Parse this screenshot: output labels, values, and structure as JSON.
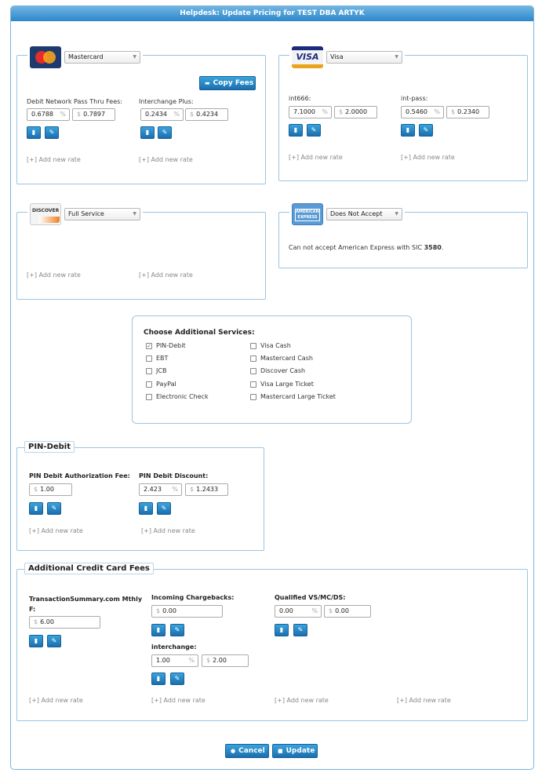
{
  "title": "Helpdesk: Update Pricing for TEST DBA ARTYK",
  "common": {
    "add_new_rate": "[+] Add new rate",
    "percent": "%",
    "dollar": "$",
    "delete_icon": "trash-icon",
    "edit_icon": "pencil-icon"
  },
  "mastercard": {
    "select_value": "Mastercard",
    "copy_fees_label": "Copy Fees",
    "rates": [
      {
        "label": "Debit Network Pass Thru Fees:",
        "percent": "0.6788",
        "fixed": "0.7897"
      },
      {
        "label": "Interchange Plus:",
        "percent": "0.2434",
        "fixed": "0.4234"
      }
    ]
  },
  "visa": {
    "select_value": "Visa",
    "rates": [
      {
        "label": "int666:",
        "percent": "7.1000",
        "fixed": "2.0000"
      },
      {
        "label": "int-pass:",
        "percent": "0.5460",
        "fixed": "0.2340"
      }
    ]
  },
  "discover": {
    "select_value": "Full Service"
  },
  "amex": {
    "select_value": "Does Not Accept",
    "message_prefix": "Can not accept American Express with SIC",
    "sic": "3580",
    "message_suffix": "."
  },
  "additional_services": {
    "title": "Choose Additional Services:",
    "left": [
      {
        "label": "PIN-Debit",
        "checked": true
      },
      {
        "label": "EBT",
        "checked": false
      },
      {
        "label": "JCB",
        "checked": false
      },
      {
        "label": "PayPal",
        "checked": false
      },
      {
        "label": "Electronic Check",
        "checked": false
      }
    ],
    "right": [
      {
        "label": "Visa Cash",
        "checked": false
      },
      {
        "label": "Mastercard Cash",
        "checked": false
      },
      {
        "label": "Discover Cash",
        "checked": false
      },
      {
        "label": "Visa Large Ticket",
        "checked": false
      },
      {
        "label": "Mastercard Large Ticket",
        "checked": false
      }
    ]
  },
  "pin_debit": {
    "title": "PIN-Debit",
    "auth_fee_label": "PIN Debit Authorization Fee:",
    "auth_fee_value": "1.00",
    "discount_label": "PIN Debit Discount:",
    "discount_percent": "2.423",
    "discount_fixed": "1.2433"
  },
  "credit_card_fees": {
    "title": "Additional Credit Card Fees",
    "ts_label_1": "TransactionSummary.com Mthly",
    "ts_label_2": "F:",
    "ts_value": "6.00",
    "chargebacks_label": "Incoming Chargebacks:",
    "chargebacks_value": "0.00",
    "interchange_label": "interchange:",
    "interchange_percent": "1.00",
    "interchange_fixed": "2.00",
    "qualified_label": "Qualified VS/MC/DS:",
    "qualified_percent": "0.00",
    "qualified_fixed": "0.00"
  },
  "footer": {
    "cancel_label": "Cancel",
    "update_label": "Update"
  }
}
